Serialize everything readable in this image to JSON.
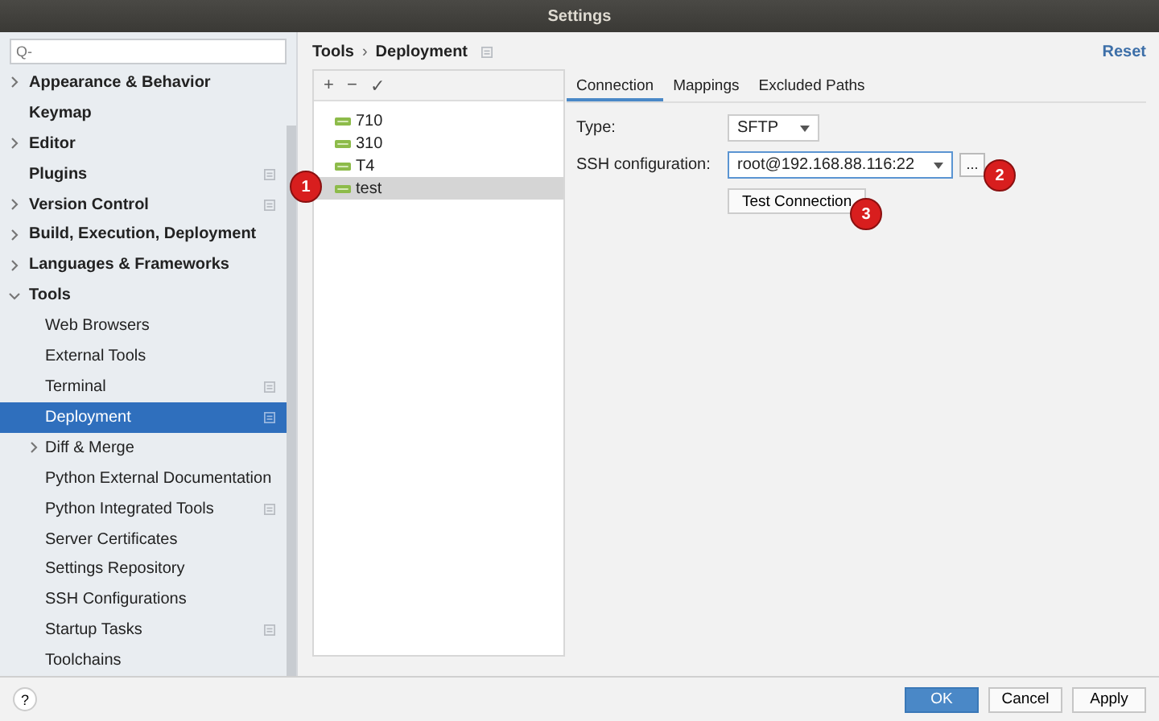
{
  "window": {
    "title": "Settings"
  },
  "search": {
    "placeholder": "Q-"
  },
  "sidebar": {
    "items": [
      {
        "label": "Appearance & Behavior",
        "expanded": false,
        "project_level": false,
        "selected": false
      },
      {
        "label": "Keymap",
        "project_level": false,
        "selected": false
      },
      {
        "label": "Editor",
        "expanded": false,
        "project_level": false,
        "selected": false
      },
      {
        "label": "Plugins",
        "project_level": true,
        "selected": false
      },
      {
        "label": "Version Control",
        "expanded": false,
        "project_level": true,
        "selected": false
      },
      {
        "label": "Build, Execution, Deployment",
        "expanded": false,
        "project_level": false,
        "selected": false
      },
      {
        "label": "Languages & Frameworks",
        "expanded": false,
        "project_level": false,
        "selected": false
      },
      {
        "label": "Tools",
        "expanded": true,
        "project_level": false,
        "selected": false,
        "children": [
          {
            "label": "Web Browsers",
            "project_level": false,
            "selected": false
          },
          {
            "label": "External Tools",
            "project_level": false,
            "selected": false
          },
          {
            "label": "Terminal",
            "project_level": true,
            "selected": false
          },
          {
            "label": "Deployment",
            "project_level": true,
            "selected": true
          },
          {
            "label": "Diff & Merge",
            "expanded": false,
            "project_level": false,
            "selected": false
          },
          {
            "label": "Python External Documentation",
            "project_level": false,
            "selected": false
          },
          {
            "label": "Python Integrated Tools",
            "project_level": true,
            "selected": false
          },
          {
            "label": "Server Certificates",
            "project_level": false,
            "selected": false
          },
          {
            "label": "Settings Repository",
            "project_level": false,
            "selected": false
          },
          {
            "label": "SSH Configurations",
            "project_level": false,
            "selected": false
          },
          {
            "label": "Startup Tasks",
            "project_level": true,
            "selected": false
          },
          {
            "label": "Toolchains",
            "project_level": false,
            "selected": false
          }
        ]
      }
    ]
  },
  "breadcrumb": {
    "parent": "Tools",
    "separator": "›",
    "current": "Deployment",
    "reset": "Reset"
  },
  "toolbar": [
    "+",
    "−",
    "✓"
  ],
  "servers": [
    {
      "name": "710",
      "selected": false
    },
    {
      "name": "310",
      "selected": false
    },
    {
      "name": "T4",
      "selected": false
    },
    {
      "name": "test",
      "selected": true
    }
  ],
  "tabs": [
    {
      "label": "Connection",
      "selected": true
    },
    {
      "label": "Mappings",
      "selected": false
    },
    {
      "label": "Excluded Paths",
      "selected": false
    }
  ],
  "form": {
    "type_label": "Type:",
    "type_value": "SFTP",
    "ssh_label": "SSH configuration:",
    "ssh_value": "root@192.168.88.116:22",
    "browse": "...",
    "test_button": "Test Connection"
  },
  "annotations": [
    "1",
    "2",
    "3"
  ],
  "help": "?",
  "buttons": [
    {
      "label": "OK",
      "kind": "primary"
    },
    {
      "label": "Cancel",
      "kind": "normal"
    },
    {
      "label": "Apply",
      "kind": "normal"
    }
  ]
}
